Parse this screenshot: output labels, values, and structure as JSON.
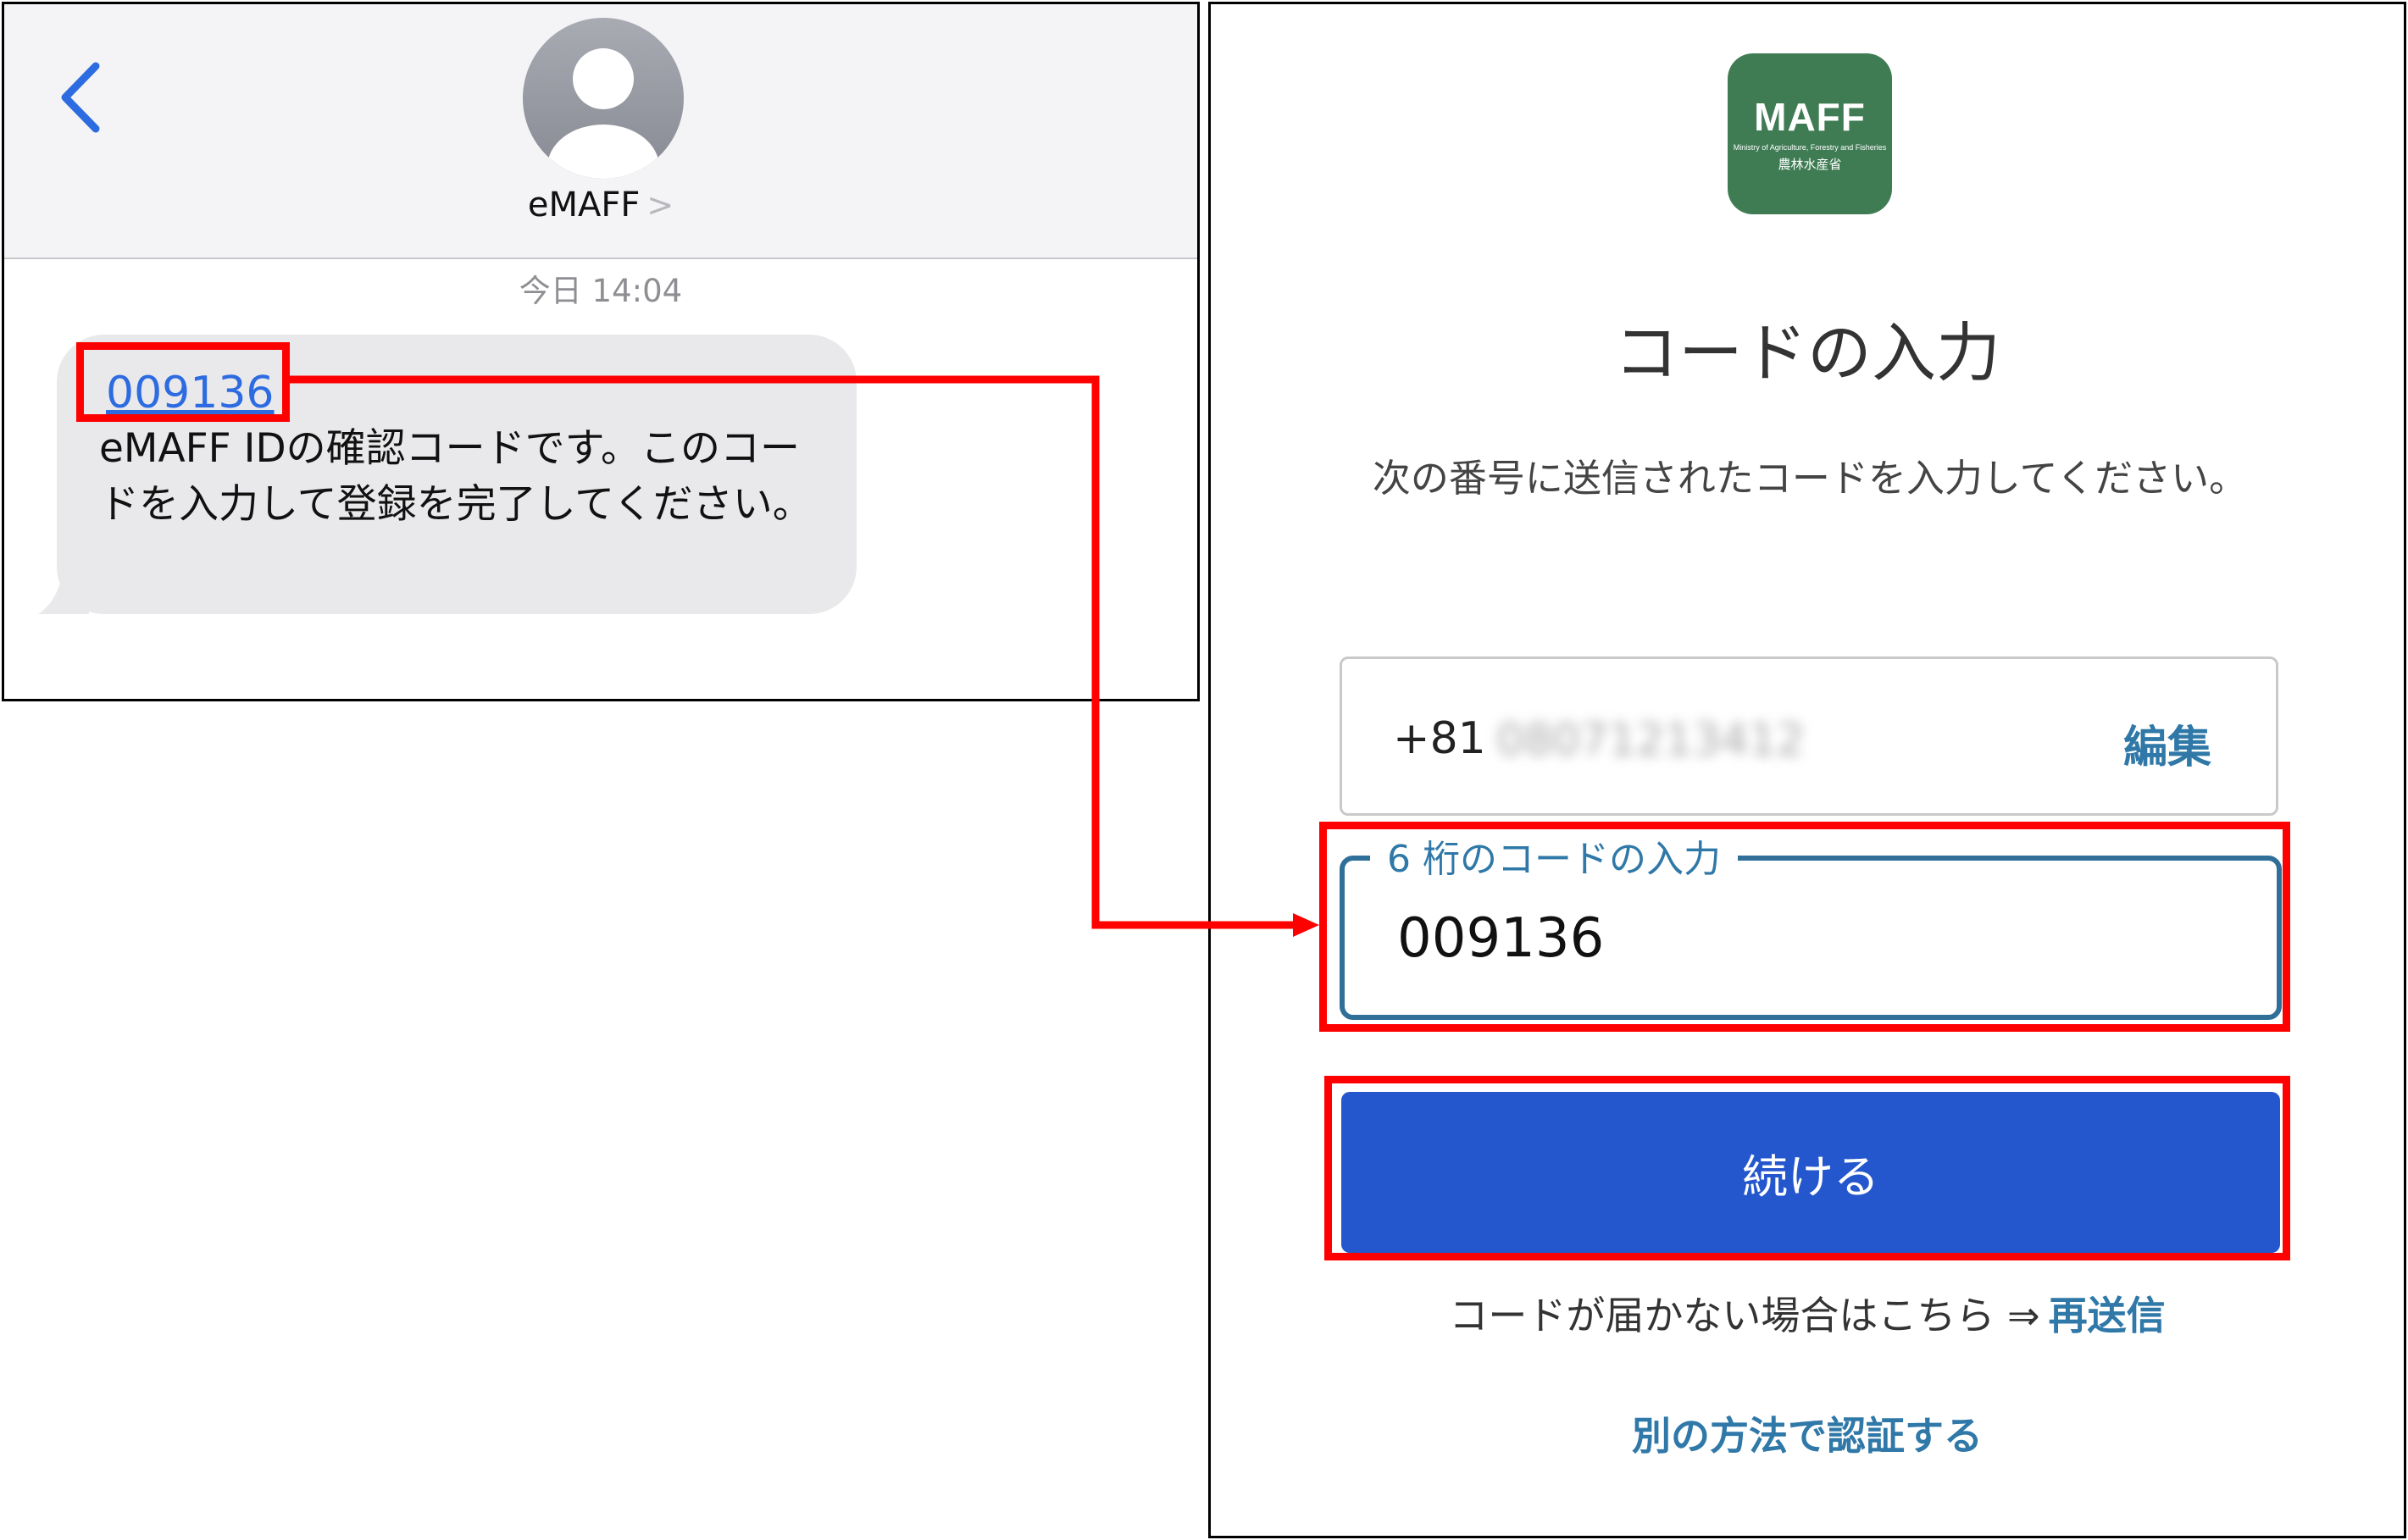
{
  "sms": {
    "contact_name": "eMAFF",
    "contact_chevron": ">",
    "timestamp": "今日 14:04",
    "code": "009136",
    "body": " eMAFF IDの確認コードです。このコードを入力して登録を完了してください。"
  },
  "auth": {
    "logo": {
      "brand": "MAFF",
      "subtitle": "Ministry of Agriculture, Forestry and Fisheries",
      "japanese": "農林水産省"
    },
    "title": "コードの入力",
    "instruction": "次の番号に送信されたコードを入力してください。",
    "phone_prefix": "+81",
    "phone_number": "08071213412",
    "edit_label": "編集",
    "code_label": "6 桁のコードの入力",
    "code_value": "009136",
    "continue_label": "続ける",
    "resend_text": "コードが届かない場合はこちら ⇒",
    "resend_link": "再送信",
    "alt_auth_label": "別の方法で認証する"
  },
  "colors": {
    "link_blue": "#2f78a8",
    "button_blue": "#2457cd",
    "logo_green": "#3f7c54",
    "annotation_red": "#ff0000"
  }
}
